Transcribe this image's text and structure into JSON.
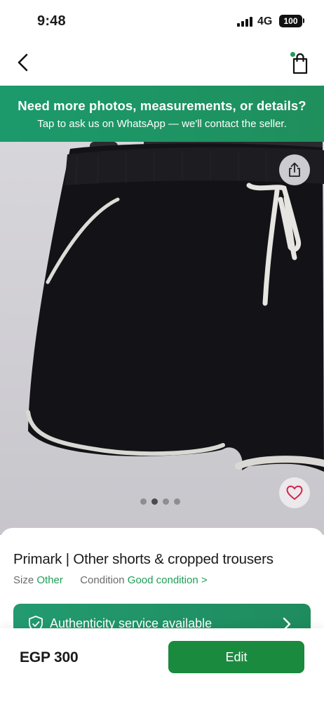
{
  "status_bar": {
    "time": "9:48",
    "network": "4G",
    "battery": "100"
  },
  "nav": {
    "back_icon": "chevron-left-icon",
    "bag_icon": "shopping-bag-icon",
    "bag_badge_color": "#1e9e57"
  },
  "whatsapp_banner": {
    "title": "Need more photos, measurements, or details?",
    "subtitle": "Tap to ask us on WhatsApp — we'll contact the seller.",
    "background": "#1f9464"
  },
  "gallery": {
    "image_count": 4,
    "active_index": 1,
    "share_icon": "share-icon",
    "favorite_icon": "heart-icon"
  },
  "product": {
    "title": "Primark | Other shorts & cropped trousers",
    "size_label": "Size",
    "size_value": "Other",
    "condition_label": "Condition",
    "condition_value": "Good condition",
    "condition_chevron": ">",
    "accent_color": "#1e9e57"
  },
  "authenticity": {
    "label": "Authenticity service available",
    "icon": "shield-check-icon"
  },
  "footer": {
    "price": "EGP 300",
    "edit_label": "Edit",
    "edit_color": "#1a8a3f"
  }
}
